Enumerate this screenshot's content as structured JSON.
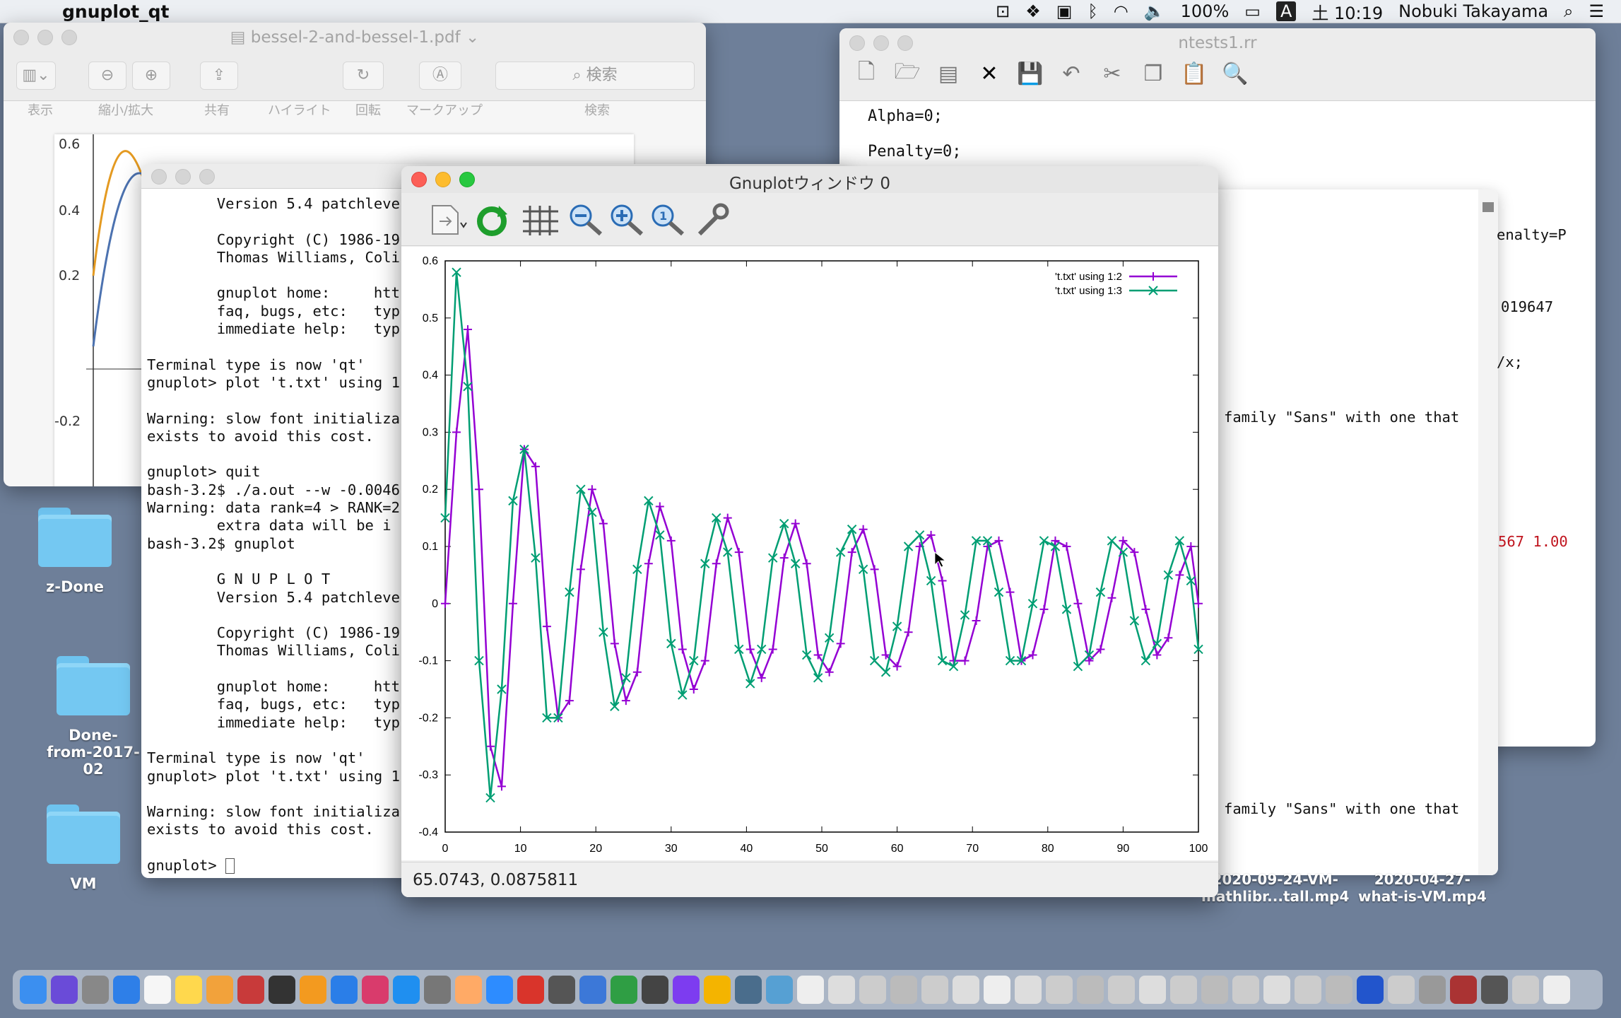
{
  "menubar": {
    "app_name": "gnuplot_qt",
    "battery": "100%",
    "time": "土 10:19",
    "user": "Nobuki Takayama",
    "input": "A"
  },
  "preview": {
    "title": "bessel-2-and-bessel-1.pdf",
    "toolbar_labels": [
      "表示",
      "縮小/拡大",
      "共有",
      "ハイライト",
      "回転",
      "マークアップ",
      "検索"
    ],
    "search_placeholder": "検索",
    "y_ticks": [
      "0.6",
      "0.4",
      "0.2",
      "-0.2"
    ]
  },
  "editor": {
    "title": "ntests1.rr",
    "lines": [
      "Alpha=0;",
      "Penalty=0;"
    ],
    "fragments": {
      "penalty": "enalty=P",
      "num": "019647",
      "x": "/x;",
      "family1": "family \"Sans\" with one that",
      "red": "567 1.00",
      "family2": "family \"Sans\" with one that"
    }
  },
  "terminal": {
    "lines": [
      "        Version 5.4 patchleve",
      "",
      "        Copyright (C) 1986-19",
      "        Thomas Williams, Coli",
      "",
      "        gnuplot home:     htt",
      "        faq, bugs, etc:   typ",
      "        immediate help:   typ",
      "",
      "Terminal type is now 'qt'",
      "gnuplot> plot 't.txt' using 1",
      "",
      "Warning: slow font initializa",
      "exists to avoid this cost.",
      "",
      "gnuplot> quit",
      "bash-3.2$ ./a.out --w -0.0046",
      "Warning: data rank=4 > RANK=2",
      "        extra data will be i",
      "bash-3.2$ gnuplot",
      "",
      "        G N U P L O T",
      "        Version 5.4 patchleve",
      "",
      "        Copyright (C) 1986-19",
      "        Thomas Williams, Coli",
      "",
      "        gnuplot home:     htt",
      "        faq, bugs, etc:   typ",
      "        immediate help:   typ",
      "",
      "Terminal type is now 'qt'",
      "gnuplot> plot 't.txt' using 1",
      "",
      "Warning: slow font initializa",
      "exists to avoid this cost.",
      "",
      "gnuplot> "
    ]
  },
  "desktop": {
    "icons": [
      "z-Done",
      "Done-\nfrom-2017-02",
      "VM"
    ],
    "videos": [
      "2020-09-24-VM-\nmathlibr...tall.mp4",
      "2020-04-27-\nwhat-is-VM.mp4"
    ]
  },
  "gnuplot": {
    "title": "Gnuplotウィンドウ 0",
    "status": "65.0743,  0.0875811",
    "colors": {
      "purple": "#9400d3",
      "green": "#009e73"
    }
  },
  "chart_data": {
    "type": "line",
    "title": "",
    "xlabel": "",
    "ylabel": "",
    "xlim": [
      0,
      100
    ],
    "ylim": [
      -0.4,
      0.6
    ],
    "x_ticks": [
      0,
      10,
      20,
      30,
      40,
      50,
      60,
      70,
      80,
      90,
      100
    ],
    "y_ticks": [
      -0.4,
      -0.3,
      -0.2,
      -0.1,
      0,
      0.1,
      0.2,
      0.3,
      0.4,
      0.5,
      0.6
    ],
    "legend_position": "top-right",
    "series": [
      {
        "name": "'t.txt' using 1:2",
        "marker": "+",
        "color": "#9400d3",
        "x": [
          0,
          1.5,
          3,
          4.5,
          6,
          7.5,
          9,
          10.5,
          12,
          13.5,
          15,
          16.5,
          18,
          19.5,
          21,
          22.5,
          24,
          25.5,
          27,
          28.5,
          30,
          31.5,
          33,
          34.5,
          36,
          37.5,
          39,
          40.5,
          42,
          43.5,
          45,
          46.5,
          48,
          49.5,
          51,
          52.5,
          54,
          55.5,
          57,
          58.5,
          60,
          61.5,
          63,
          64.5,
          66,
          67.5,
          69,
          70.5,
          72,
          73.5,
          75,
          76.5,
          78,
          79.5,
          81,
          82.5,
          84,
          85.5,
          87,
          88.5,
          90,
          91.5,
          93,
          94.5,
          96,
          97.5,
          99,
          100
        ],
        "y": [
          0,
          0.3,
          0.48,
          0.2,
          -0.25,
          -0.32,
          0.0,
          0.27,
          0.24,
          -0.04,
          -0.2,
          -0.17,
          0.06,
          0.2,
          0.14,
          -0.07,
          -0.17,
          -0.12,
          0.07,
          0.17,
          0.11,
          -0.08,
          -0.15,
          -0.1,
          0.07,
          0.15,
          0.09,
          -0.08,
          -0.13,
          -0.08,
          0.08,
          0.14,
          0.07,
          -0.09,
          -0.12,
          -0.07,
          0.09,
          0.13,
          0.06,
          -0.09,
          -0.11,
          -0.05,
          0.1,
          0.12,
          0.04,
          -0.1,
          -0.1,
          -0.03,
          0.1,
          0.11,
          0.02,
          -0.1,
          -0.09,
          -0.01,
          0.11,
          0.1,
          0.0,
          -0.1,
          -0.08,
          0.01,
          0.11,
          0.09,
          -0.01,
          -0.09,
          -0.06,
          0.05,
          0.1,
          0.0
        ]
      },
      {
        "name": "'t.txt' using 1:3",
        "marker": "x",
        "color": "#009e73",
        "x": [
          0,
          1.5,
          3,
          4.5,
          6,
          7.5,
          9,
          10.5,
          12,
          13.5,
          15,
          16.5,
          18,
          19.5,
          21,
          22.5,
          24,
          25.5,
          27,
          28.5,
          30,
          31.5,
          33,
          34.5,
          36,
          37.5,
          39,
          40.5,
          42,
          43.5,
          45,
          46.5,
          48,
          49.5,
          51,
          52.5,
          54,
          55.5,
          57,
          58.5,
          60,
          61.5,
          63,
          64.5,
          66,
          67.5,
          69,
          70.5,
          72,
          73.5,
          75,
          76.5,
          78,
          79.5,
          81,
          82.5,
          84,
          85.5,
          87,
          88.5,
          90,
          91.5,
          93,
          94.5,
          96,
          97.5,
          99,
          100
        ],
        "y": [
          0.15,
          0.58,
          0.38,
          -0.1,
          -0.34,
          -0.15,
          0.18,
          0.27,
          0.08,
          -0.2,
          -0.2,
          0.02,
          0.2,
          0.16,
          -0.05,
          -0.18,
          -0.13,
          0.06,
          0.18,
          0.12,
          -0.07,
          -0.16,
          -0.1,
          0.07,
          0.15,
          0.09,
          -0.08,
          -0.14,
          -0.08,
          0.08,
          0.14,
          0.07,
          -0.09,
          -0.13,
          -0.06,
          0.09,
          0.13,
          0.06,
          -0.1,
          -0.12,
          -0.04,
          0.1,
          0.12,
          0.04,
          -0.1,
          -0.11,
          -0.02,
          0.11,
          0.11,
          0.02,
          -0.1,
          -0.1,
          0.0,
          0.11,
          0.1,
          -0.01,
          -0.11,
          -0.09,
          0.02,
          0.11,
          0.09,
          -0.03,
          -0.1,
          -0.07,
          0.05,
          0.11,
          0.04,
          -0.08
        ]
      }
    ]
  }
}
